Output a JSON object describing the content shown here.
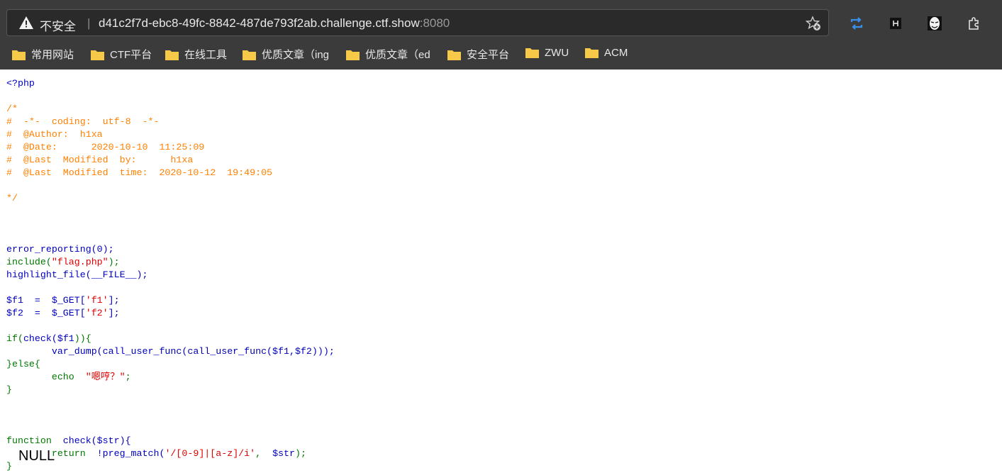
{
  "browser": {
    "security_label": "不安全",
    "separator": "|",
    "url_host": "d41c2f7d-ebc8-49fc-8842-487de793f2ab.challenge.ctf.show",
    "url_port": ":8080",
    "icons": [
      "warning-icon",
      "favorite-star-icon",
      "sync-icon",
      "h-extension-icon",
      "mask-extension-icon",
      "puzzle-extension-icon"
    ]
  },
  "bookmarks": [
    {
      "label": "常用网站"
    },
    {
      "label": "CTF平台"
    },
    {
      "label": "在线工具"
    },
    {
      "label": "优质文章（ing"
    },
    {
      "label": "优质文章（ed"
    },
    {
      "label": "安全平台"
    },
    {
      "label": "ZWU"
    },
    {
      "label": "ACM"
    }
  ],
  "code": {
    "open_tag": "<?php",
    "comment": "/*\n#  -*-  coding:  utf-8  -*-\n#  @Author:  h1xa\n#  @Date:      2020-10-10  11:25:09\n#  @Last  Modified  by:      h1xa\n#  @Last  Modified  time:  2020-10-12  19:49:05\n\n*/",
    "l_error": "error_reporting(0);",
    "l_include_kw": "include(",
    "l_include_str": "\"flag.php\"",
    "l_include_end": ");",
    "l_highlight": "highlight_file(__FILE__);",
    "l_f1_a": "$f1  =  $_GET[",
    "l_f1_s": "'f1'",
    "l_f1_b": "];",
    "l_f2_a": "$f2  =  $_GET[",
    "l_f2_s": "'f2'",
    "l_f2_b": "];",
    "l_if_kw": "if(",
    "l_if_fn": "check(",
    "l_if_var": "$f1",
    "l_if_end": ")){",
    "l_vardump": "        var_dump(call_user_func(call_user_func($f1,$f2)));",
    "l_else": "}else{",
    "l_echo_kw": "        echo  ",
    "l_echo_str": "\"嗯哼？\"",
    "l_echo_end": ";",
    "l_close": "}",
    "l_func_kw": "function  ",
    "l_func_sig": "check($str){",
    "l_return_kw": "        return  ",
    "l_return_expr": "!preg_match(",
    "l_return_str": "'/[0-9]|[a-z]/i'",
    "l_return_tail": ",  ",
    "l_return_var": "$str",
    "l_return_end": ");",
    "l_final": "}"
  },
  "output": "NULL"
}
